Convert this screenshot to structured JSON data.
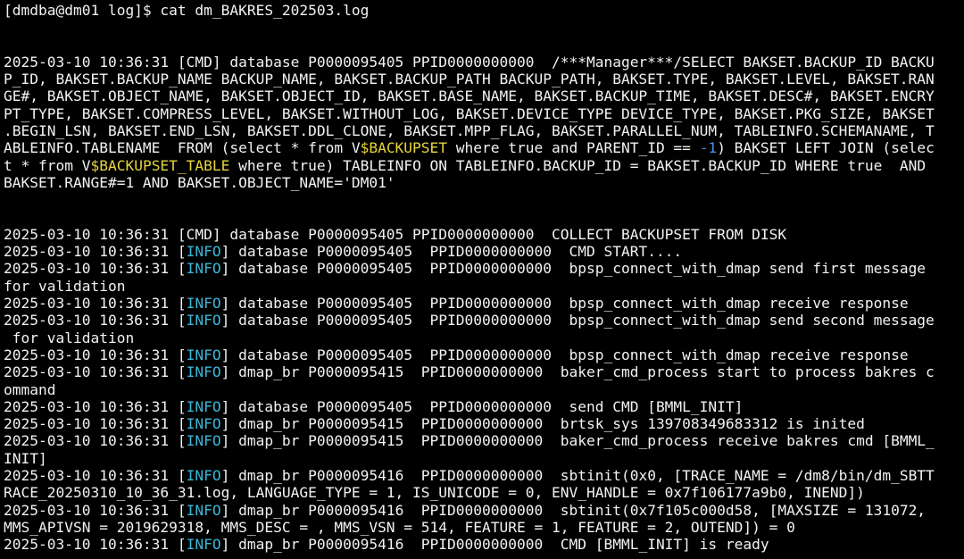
{
  "terminal": {
    "lines": [
      {
        "segments": [
          {
            "text": "[dmdba@dm01 log]$ cat dm_BAKRES_202503.log"
          }
        ]
      },
      {
        "segments": [
          {
            "text": ""
          }
        ]
      },
      {
        "segments": [
          {
            "text": ""
          }
        ]
      },
      {
        "segments": [
          {
            "text": "2025-03-10 10:36:31 [CMD] database P0000095405 PPID0000000000  /***Manager***/SELECT BAKSET.BACKUP_ID BACKU"
          }
        ]
      },
      {
        "segments": [
          {
            "text": "P_ID, BAKSET.BACKUP_NAME BACKUP_NAME, BAKSET.BACKUP_PATH BACKUP_PATH, BAKSET.TYPE, BAKSET.LEVEL, BAKSET.RAN"
          }
        ]
      },
      {
        "segments": [
          {
            "text": "GE#, BAKSET.OBJECT_NAME, BAKSET.OBJECT_ID, BAKSET.BASE_NAME, BAKSET.BACKUP_TIME, BAKSET.DESC#, BAKSET.ENCRY"
          }
        ]
      },
      {
        "segments": [
          {
            "text": "PT_TYPE, BAKSET.COMPRESS_LEVEL, BAKSET.WITHOUT_LOG, BAKSET.DEVICE_TYPE DEVICE_TYPE, BAKSET.PKG_SIZE, BAKSET"
          }
        ]
      },
      {
        "segments": [
          {
            "text": ".BEGIN_LSN, BAKSET.END_LSN, BAKSET.DDL_CLONE, BAKSET.MPP_FLAG, BAKSET.PARALLEL_NUM, TABLEINFO.SCHEMANAME, T"
          }
        ]
      },
      {
        "segments": [
          {
            "text": "ABLEINFO.TABLENAME  FROM (select * from V"
          },
          {
            "text": "$BACKUPSET",
            "cls": "hl-yellow"
          },
          {
            "text": " where true and PARENT_ID == "
          },
          {
            "text": "-1",
            "cls": "hl-blue"
          },
          {
            "text": ") BAKSET LEFT JOIN (selec"
          }
        ]
      },
      {
        "segments": [
          {
            "text": "t * from V"
          },
          {
            "text": "$BACKUPSET_TABLE",
            "cls": "hl-yellow"
          },
          {
            "text": " where true) TABLEINFO ON TABLEINFO.BACKUP_ID = BAKSET.BACKUP_ID WHERE true  AND"
          }
        ]
      },
      {
        "segments": [
          {
            "text": "BAKSET.RANGE#=1 AND BAKSET.OBJECT_NAME='DM01'"
          }
        ]
      },
      {
        "segments": [
          {
            "text": ""
          }
        ]
      },
      {
        "segments": [
          {
            "text": ""
          }
        ]
      },
      {
        "segments": [
          {
            "text": "2025-03-10 10:36:31 [CMD] database P0000095405 PPID0000000000  COLLECT BACKUPSET FROM DISK"
          }
        ]
      },
      {
        "segments": [
          {
            "text": "2025-03-10 10:36:31 ["
          },
          {
            "text": "INFO",
            "cls": "hl-cyan"
          },
          {
            "text": "] database P0000095405  PPID0000000000  CMD START...."
          }
        ]
      },
      {
        "segments": [
          {
            "text": "2025-03-10 10:36:31 ["
          },
          {
            "text": "INFO",
            "cls": "hl-cyan"
          },
          {
            "text": "] database P0000095405  PPID0000000000  bpsp_connect_with_dmap send first message"
          }
        ]
      },
      {
        "segments": [
          {
            "text": "for validation"
          }
        ]
      },
      {
        "segments": [
          {
            "text": "2025-03-10 10:36:31 ["
          },
          {
            "text": "INFO",
            "cls": "hl-cyan"
          },
          {
            "text": "] database P0000095405  PPID0000000000  bpsp_connect_with_dmap receive response"
          }
        ]
      },
      {
        "segments": [
          {
            "text": "2025-03-10 10:36:31 ["
          },
          {
            "text": "INFO",
            "cls": "hl-cyan"
          },
          {
            "text": "] database P0000095405  PPID0000000000  bpsp_connect_with_dmap send second message"
          }
        ]
      },
      {
        "segments": [
          {
            "text": " for validation"
          }
        ]
      },
      {
        "segments": [
          {
            "text": "2025-03-10 10:36:31 ["
          },
          {
            "text": "INFO",
            "cls": "hl-cyan"
          },
          {
            "text": "] database P0000095405  PPID0000000000  bpsp_connect_with_dmap receive response"
          }
        ]
      },
      {
        "segments": [
          {
            "text": "2025-03-10 10:36:31 ["
          },
          {
            "text": "INFO",
            "cls": "hl-cyan"
          },
          {
            "text": "] dmap_br P0000095415  PPID0000000000  baker_cmd_process start to process bakres c"
          }
        ]
      },
      {
        "segments": [
          {
            "text": "ommand"
          }
        ]
      },
      {
        "segments": [
          {
            "text": "2025-03-10 10:36:31 ["
          },
          {
            "text": "INFO",
            "cls": "hl-cyan"
          },
          {
            "text": "] database P0000095405  PPID0000000000  send CMD [BMML_INIT]"
          }
        ]
      },
      {
        "segments": [
          {
            "text": "2025-03-10 10:36:31 ["
          },
          {
            "text": "INFO",
            "cls": "hl-cyan"
          },
          {
            "text": "] dmap_br P0000095415  PPID0000000000  brtsk_sys 139708349683312 is inited"
          }
        ]
      },
      {
        "segments": [
          {
            "text": "2025-03-10 10:36:31 ["
          },
          {
            "text": "INFO",
            "cls": "hl-cyan"
          },
          {
            "text": "] dmap_br P0000095415  PPID0000000000  baker_cmd_process receive bakres cmd [BMML_"
          }
        ]
      },
      {
        "segments": [
          {
            "text": "INIT]"
          }
        ]
      },
      {
        "segments": [
          {
            "text": "2025-03-10 10:36:31 ["
          },
          {
            "text": "INFO",
            "cls": "hl-cyan"
          },
          {
            "text": "] dmap_br P0000095416  PPID0000000000  sbtinit(0x0, [TRACE_NAME = /dm8/bin/dm_SBTT"
          }
        ]
      },
      {
        "segments": [
          {
            "text": "RACE_20250310_10_36_31.log, LANGUAGE_TYPE = 1, IS_UNICODE = 0, ENV_HANDLE = 0x7f106177a9b0, INEND])"
          }
        ]
      },
      {
        "segments": [
          {
            "text": "2025-03-10 10:36:31 ["
          },
          {
            "text": "INFO",
            "cls": "hl-cyan"
          },
          {
            "text": "] dmap_br P0000095416  PPID0000000000  sbtinit(0x7f105c000d58, [MAXSIZE = 131072,"
          }
        ]
      },
      {
        "segments": [
          {
            "text": "MMS_APIVSN = 2019629318, MMS_DESC = , MMS_VSN = 514, FEATURE = 1, FEATURE = 2, OUTEND]) = 0"
          }
        ]
      },
      {
        "segments": [
          {
            "text": "2025-03-10 10:36:31 ["
          },
          {
            "text": "INFO",
            "cls": "hl-cyan"
          },
          {
            "text": "] dmap_br P0000095416  PPID0000000000  CMD [BMML_INIT] is ready"
          }
        ]
      }
    ]
  }
}
